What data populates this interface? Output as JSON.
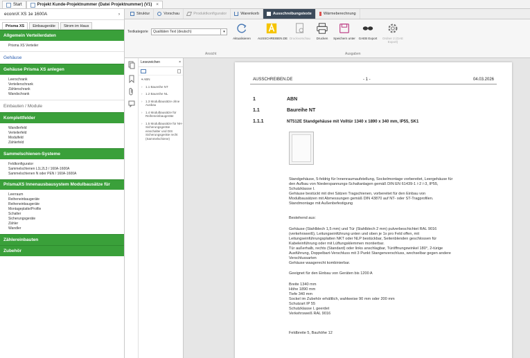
{
  "top_tabs": [
    {
      "label": "Start"
    },
    {
      "label": "Projekt Kunde-Projektnummer (Datei Projektnummer) (V1)",
      "closable": "×"
    }
  ],
  "left": {
    "device": "econnX XS 1e 1600A",
    "device_arrow": "›",
    "tabs": [
      "Prisma XS",
      "Einbaugeräte",
      "Strom im Haus"
    ],
    "sections": [
      {
        "type": "head",
        "label": "Allgemein Verteilerdaten"
      },
      {
        "type": "items",
        "items": [
          "Prisma XS Verteiler"
        ]
      },
      {
        "type": "plain",
        "label": "Gehäuse",
        "style": "blue"
      },
      {
        "type": "head",
        "label": "Gehäuse Prisma XS anlegen"
      },
      {
        "type": "items",
        "items": [
          "Leerschrank",
          "Verteilerschrank",
          "Zählerschrank",
          "Wandschrank"
        ]
      },
      {
        "type": "plain",
        "label": "Einbauten / Module",
        "style": "grey"
      },
      {
        "type": "head",
        "label": "Komplettfelder"
      },
      {
        "type": "items",
        "items": [
          "Wandlerfeld",
          "Verteilerfeld",
          "Modulfeld",
          "Zählerfeld"
        ]
      },
      {
        "type": "head",
        "label": "Sammelschienen-Systeme"
      },
      {
        "type": "items",
        "items": [
          "Feldkonfigurator",
          "Sammelschienen L1L2L3 / 160A-1600A",
          "Sammelschienen N oder PEN / 160A-1600A"
        ]
      },
      {
        "type": "head",
        "label": "PrismaXS Innenausbausystem Modulbausätze für",
        "tall": true
      },
      {
        "type": "items",
        "items": [
          "Leerraum",
          "Reiheneinbaugeräte",
          "Reiheneinbaugeräte",
          "Montageplatte/Profile",
          "Schalter",
          "Sicherungsgeräte",
          "Zähler",
          "Wandler"
        ]
      },
      {
        "type": "head",
        "label": "Zählereinbauten"
      },
      {
        "type": "head",
        "label": "Zubehör"
      }
    ]
  },
  "toolbar": {
    "tabs": [
      {
        "label": "Struktur"
      },
      {
        "label": "Vorschau"
      },
      {
        "label": "Produktkonfigurator"
      },
      {
        "label": "Warenkorb"
      },
      {
        "label": "Ausschreibungstexte",
        "active": true
      },
      {
        "label": "Wärmeberechnung"
      }
    ],
    "textpos_label": "Textkategorie",
    "textpos_value": "Qualitäten Text (deutsch)",
    "buttons": [
      {
        "label": "Aktualisieren",
        "icon": "refresh-icon"
      },
      {
        "label": "AUSSCHREIBEN.DE",
        "icon": "ausschreiben-logo-icon"
      },
      {
        "label": "Druckvorschau",
        "icon": "print-preview-icon"
      },
      {
        "label": "Drucken",
        "icon": "printer-icon"
      },
      {
        "label": "Speichern unter",
        "icon": "save-icon"
      },
      {
        "label": "GAEB Export",
        "icon": "gaeb-export-icon"
      },
      {
        "label": "Ordner 2 (GAE Export)",
        "icon": "gear-icon"
      }
    ],
    "group_ansicht": "Ansicht",
    "group_ausgaben": "Ausgaben"
  },
  "bookmarks": {
    "title": "Lesezeichen",
    "close": "×",
    "items": [
      {
        "label": "ABN",
        "root": true
      },
      {
        "label": "1.1 Baureihe NT"
      },
      {
        "label": "1.2 Baureihe NL"
      },
      {
        "label": "1.3 Modulbausätze ohne Ausbau"
      },
      {
        "label": "1.4 Modulbausätze für Reiheneinbaugeräte"
      },
      {
        "label": "1.5 Modulbausätze für NH-Sicherungsgeräte einschalter und DIS Sicherungsgeräte recht (Sammelschiene)"
      }
    ]
  },
  "document": {
    "header_left": "AUSSCHREIBEN.DE",
    "header_center": "- 1 -",
    "header_right": "04.03.2026",
    "headings": [
      {
        "num": "1",
        "title": "ABN"
      },
      {
        "num": "1.1",
        "title": "Baureihe NT"
      },
      {
        "num": "1.1.1",
        "title": "NT512E Standgehäuse mit Volltür 1340 x 1890 x 340 mm, IP55, SK1"
      }
    ],
    "para1": "Standgehäuse, 5-feldrig für Innenraumaufstellung, Sockelmontage vorbereitet, Leergehäuse für\nden Aufbau von Niederspannungs-Schaltanlagen gemäß DIN EN 61439-1 /-2 /-3, IP55,\nSchutzklasse I.\nGehäuse bestückt mit drei Sätzen Tragschienen, vorbereitet für den Einbau von\nModulbausätzen mit Abmessungen gemäß DIN 43870 auf NT- oder ST-Tragprofilen.\nStandmontage mit Außenbefestigung",
    "para2": "Bestehend aus:",
    "para3": "Gehäuse (Stahlblech 1,5 mm) und Tür (Stahlblech 2 mm) pulverbeschichtet RAL 9016\n(verkehrsweiß), Leitungseinführung unten und oben je 1x pro Feld offen, mit\nLeitungseinführungsplatten NKT oder NLP bestückbar, Seitenblenden geschlossen für\nKabeleinführung oder mit Lüftungsklemmen montierbar.\nTür außerhalb, rechts (Standard) oder links anschlagbar, Türöffnungswinkel 180°, 2-türige\nAusführung, Doppelbart-Verschluss mit 3 Punkt Stangenverschluss, wechselbar gegen andere\nVerschlussarten\nGehäuse waagerecht kombinierbar.",
    "para4": "Geeignet für den Einbau von Geräten bis 1200 A",
    "para5": "Breite 1340 mm\nHöhe 1890 mm\nTiefe 340 mm\nSockel im Zubehör erhältlich, wahlweise 90 mm oder 200 mm\nSchutzart IP 55\nSchutzklasse I, geerdet\nVerkehrsweiß RAL 9016",
    "para6": "Feldbreite 5, Bauhöhe 12"
  }
}
